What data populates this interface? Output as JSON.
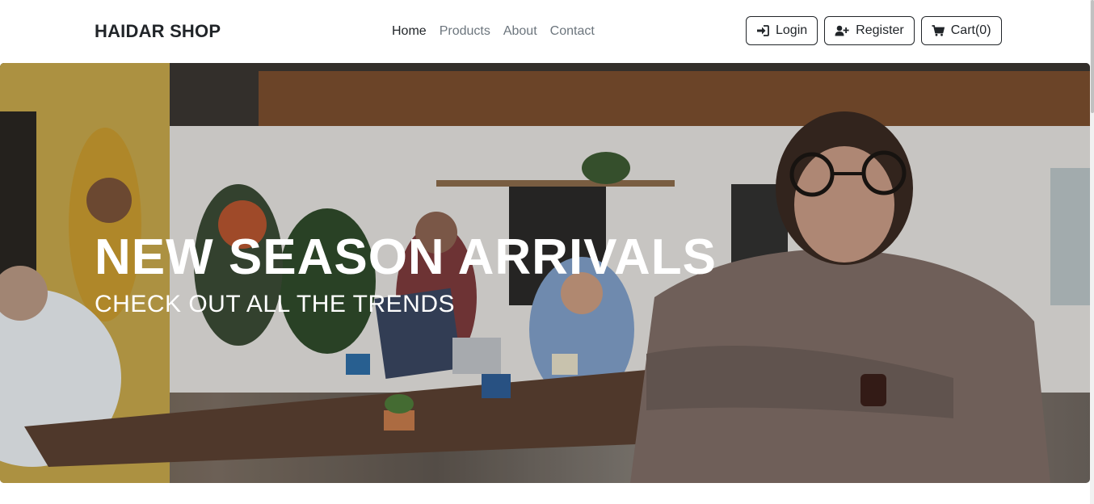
{
  "brand": "HAIDAR SHOP",
  "nav": {
    "links": [
      {
        "label": "Home",
        "active": true
      },
      {
        "label": "Products",
        "active": false
      },
      {
        "label": "About",
        "active": false
      },
      {
        "label": "Contact",
        "active": false
      }
    ]
  },
  "actions": {
    "login": {
      "label": "Login",
      "icon": "sign-in-icon"
    },
    "register": {
      "label": "Register",
      "icon": "user-plus-icon"
    },
    "cart": {
      "label": "Cart(0)",
      "icon": "cart-icon"
    }
  },
  "hero": {
    "title": "NEW SEASON ARRIVALS",
    "subtitle": "CHECK OUT ALL THE TRENDS"
  },
  "colors": {
    "text_dark": "#212529",
    "nav_muted": "#6c757d",
    "hero_text": "#ffffff"
  }
}
